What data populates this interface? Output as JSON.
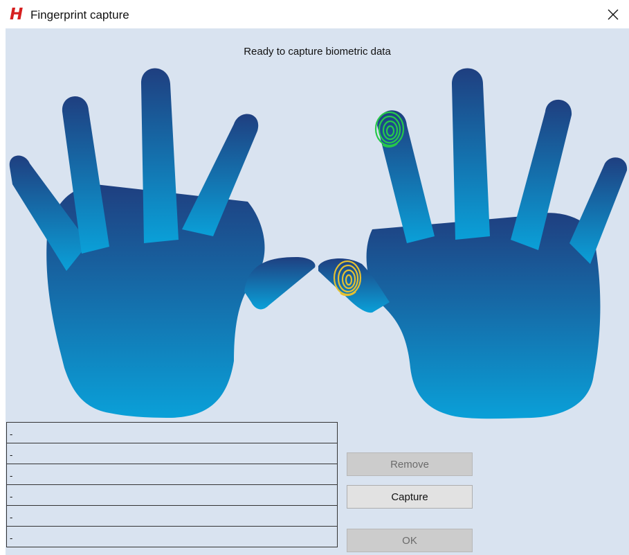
{
  "window": {
    "logo": "H",
    "title": "Fingerprint capture"
  },
  "status_text": "Ready to capture biometric data",
  "finger_list": [
    "-",
    "-",
    "-",
    "-",
    "-",
    "-"
  ],
  "buttons": {
    "remove": "Remove",
    "capture": "Capture",
    "ok": "OK"
  },
  "colors": {
    "hand_top": "#1f3f80",
    "hand_bottom": "#0aa0d8",
    "captured_ring": "#27c94a",
    "pending_ring": "#e3c032"
  }
}
